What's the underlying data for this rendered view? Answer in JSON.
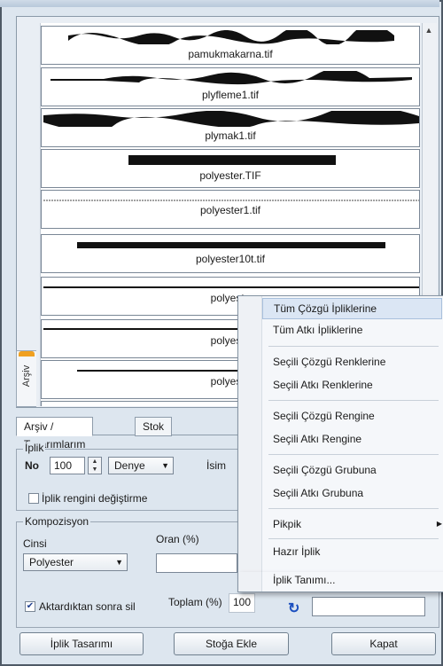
{
  "archive_tab_label": "Arşiv",
  "yarn_list": [
    {
      "name": "pamukmakarna.tif",
      "style": "cotton"
    },
    {
      "name": "plyfleme1.tif",
      "style": "fleece"
    },
    {
      "name": "plymak1.tif",
      "style": "fleece-thick"
    },
    {
      "name": "polyester.TIF",
      "style": "thick"
    },
    {
      "name": "polyester1.tif",
      "style": "thin"
    },
    {
      "name": "polyester10t.tif",
      "style": "medium"
    },
    {
      "name": "polyeste",
      "style": "thin-line"
    },
    {
      "name": "polyeste",
      "style": "thin-line"
    },
    {
      "name": "polyeste",
      "style": "thin-line"
    },
    {
      "name": "",
      "style": "thin-line"
    }
  ],
  "bottom_tabs": [
    "Arşiv / Tasarımlarım",
    "Stok"
  ],
  "iplik": {
    "group_label": "İplik",
    "no_label": "No",
    "no_value": "100",
    "denye_option": "Denye",
    "isim_label": "İsim",
    "change_color_label": "İplik rengini değiştirme"
  },
  "kompozisyon": {
    "group_label": "Kompozisyon",
    "cinsi_label": "Cinsi",
    "cinsi_value": "Polyester",
    "oran_label": "Oran (%)",
    "aktar_label": "Aktardıktan sonra sil",
    "aktar_checked": true,
    "toplam_label": "Toplam (%)",
    "toplam_value": "100"
  },
  "buttons": {
    "iplik_tasarimi": "İplik Tasarımı",
    "stoga_ekle": "Stoğa Ekle",
    "kapat": "Kapat"
  },
  "context_menu": [
    "Tüm Çözgü İpliklerine",
    "Tüm Atkı İpliklerine",
    "Seçili Çözgü Renklerine",
    "Seçili Atkı Renklerine",
    "Seçili Çözgü Rengine",
    "Seçili Atkı Rengine",
    "Seçili Çözgü Grubuna",
    "Seçili Atkı Grubuna",
    "Pikpik",
    "Hazır İplik",
    "İplik Tanımı..."
  ]
}
